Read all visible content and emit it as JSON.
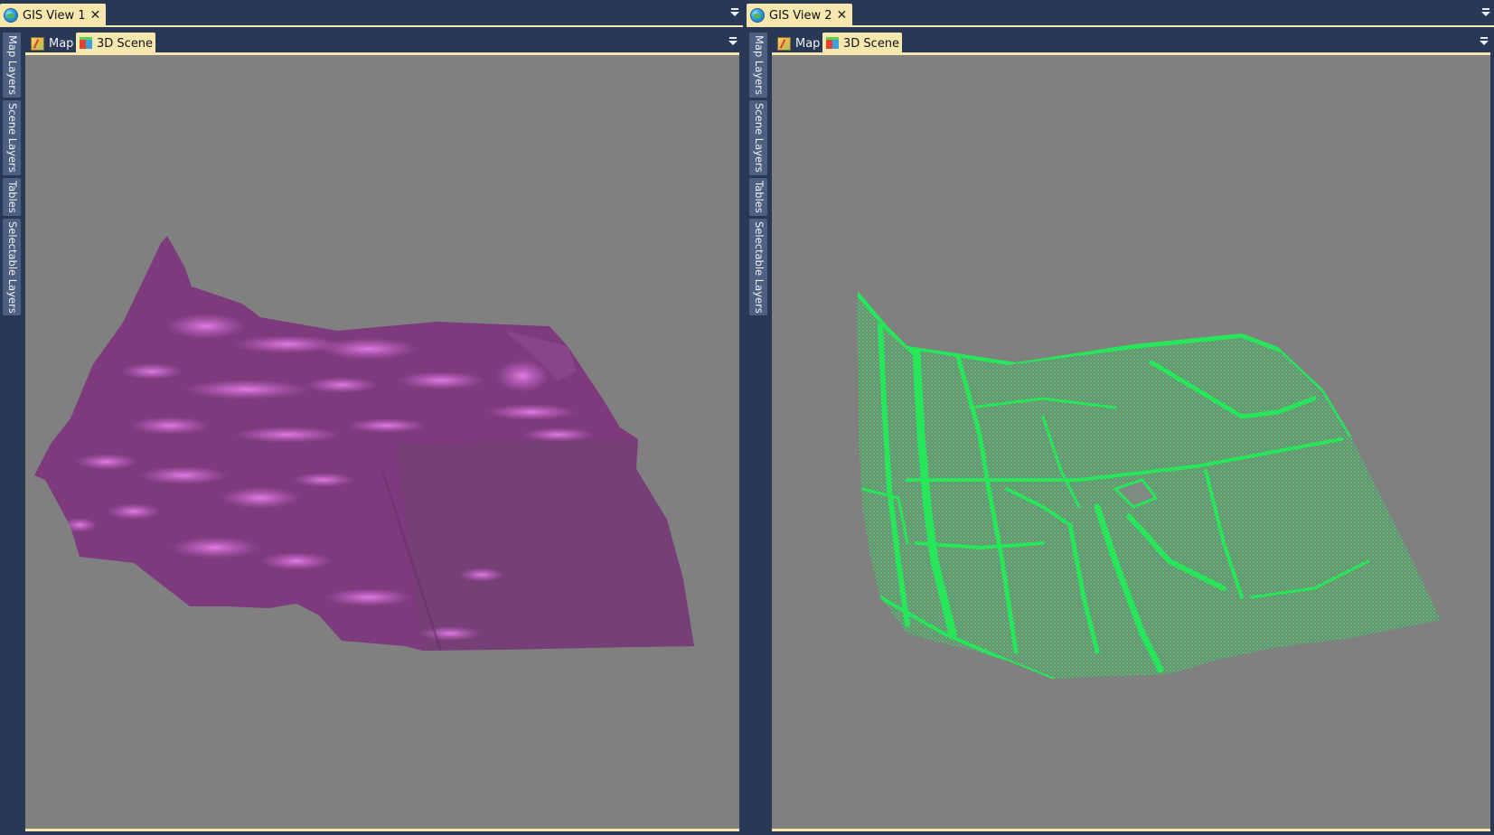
{
  "colors": {
    "frame": "#293955",
    "tab_active": "#f5e7ad",
    "viewport": "#808080",
    "surface_magenta": "#7d3b7d",
    "surface_highlight": "#d36ad6",
    "points_green": "#27e65a"
  },
  "views": [
    {
      "tab_label": "GIS View 1",
      "side_tabs": [
        "Map Layers",
        "Scene Layers",
        "Tables",
        "Selectable Layers"
      ],
      "view_tabs": [
        {
          "label": "Map",
          "icon": "map-icon",
          "active": false
        },
        {
          "label": "3D Scene",
          "icon": "cube-icon",
          "active": true
        }
      ]
    },
    {
      "tab_label": "GIS View 2",
      "side_tabs": [
        "Map Layers",
        "Scene Layers",
        "Tables",
        "Selectable Layers"
      ],
      "view_tabs": [
        {
          "label": "Map",
          "icon": "map-icon",
          "active": false
        },
        {
          "label": "3D Scene",
          "icon": "cube-icon",
          "active": true
        }
      ]
    }
  ]
}
